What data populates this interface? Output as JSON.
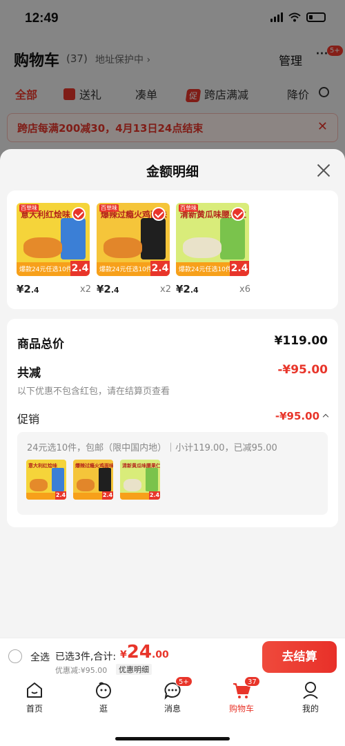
{
  "status": {
    "time": "12:49"
  },
  "header": {
    "title": "购物车",
    "count": "(37)",
    "address": "地址保护中 ›",
    "manage": "管理",
    "more_badge": "5+"
  },
  "categories": [
    {
      "label": "全部",
      "active": true
    },
    {
      "label": "送礼"
    },
    {
      "label": "凑单"
    },
    {
      "label": "跨店满减",
      "tag": "促"
    },
    {
      "label": "降价"
    }
  ],
  "banner": {
    "text": "跨店每满200减30，4月13日24点结束",
    "close": "✕"
  },
  "sheet": {
    "title": "金额明细",
    "products": [
      {
        "top_text": "意大利红烩味",
        "price_int": "¥2",
        "price_dec": ".4",
        "qty": "x2",
        "pack_color": "#3b7fd6",
        "nut_color": "#e58a2a",
        "bg": "#f5d43a",
        "strip_text": "爆款24元任选10件",
        "tag": "2.4",
        "logo": "百草味"
      },
      {
        "top_text": "爆辣过瘾火鸡面味",
        "price_int": "¥2",
        "price_dec": ".4",
        "qty": "x2",
        "pack_color": "#1f1f1f",
        "nut_color": "#e2862a",
        "bg": "#f5c53a",
        "strip_text": "爆款24元任选10件",
        "tag": "2.4",
        "logo": "百草味"
      },
      {
        "top_text": "清新黄瓜味腰果仁",
        "price_int": "¥2",
        "price_dec": ".4",
        "qty": "x6",
        "pack_color": "#7ac34c",
        "nut_color": "#e9e2c9",
        "bg": "#d9ec7a",
        "strip_text": "爆款24元任选10件",
        "tag": "2.4",
        "logo": "百草味"
      }
    ],
    "summary": {
      "total_label": "商品总价",
      "total_value": "¥119.00",
      "reduce_label": "共减",
      "reduce_value": "-¥95.00",
      "note": "以下优惠不包含红包，请在结算页查看",
      "promo_label": "促销",
      "promo_value": "-¥95.00",
      "promo_desc": "24元选10件，包邮（限中国内地）｜小计119.00，已减95.00"
    }
  },
  "checkout": {
    "select_all": "全选",
    "selected": "已选3件,合计:",
    "currency": "¥",
    "total_big": "24",
    "total_dec": ".00",
    "discount": "优惠减:¥95.00",
    "detail": "优惠明细",
    "button": "去结算"
  },
  "tabs": [
    {
      "label": "首页",
      "icon": "home-icon"
    },
    {
      "label": "逛",
      "icon": "browse-icon"
    },
    {
      "label": "消息",
      "icon": "message-icon",
      "badge": "5+"
    },
    {
      "label": "购物车",
      "icon": "cart-icon",
      "badge": "37",
      "active": true
    },
    {
      "label": "我的",
      "icon": "profile-icon"
    }
  ],
  "colors": {
    "accent": "#e8352a",
    "overlay": "rgba(0,0,0,0.45)"
  }
}
